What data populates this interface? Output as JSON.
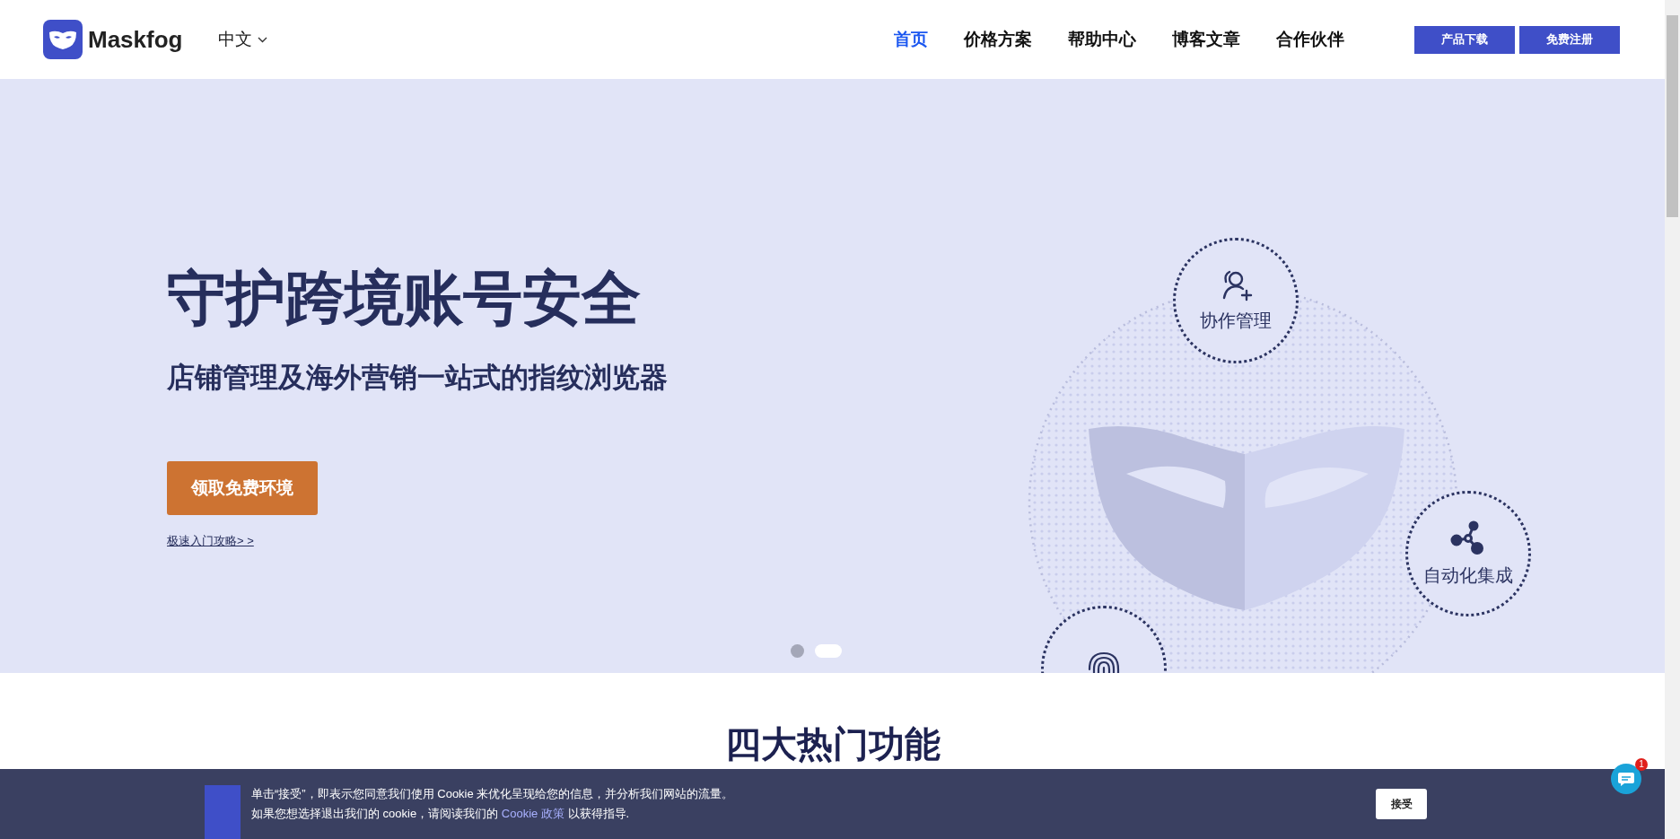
{
  "header": {
    "logo": "Maskfog",
    "language": "中文",
    "nav": [
      {
        "label": "首页",
        "selected": true
      },
      {
        "label": "价格方案",
        "selected": false
      },
      {
        "label": "帮助中心",
        "selected": false
      },
      {
        "label": "博客文章",
        "selected": false
      },
      {
        "label": "合作伙伴",
        "selected": false
      }
    ],
    "buttons": [
      "产品下载",
      "免费注册"
    ]
  },
  "hero": {
    "title": "守护跨境账号安全",
    "subtitle": "店铺管理及海外营销一站式的指纹浏览器",
    "cta": "领取免费环境",
    "link": "极速入门攻略> >",
    "features": [
      {
        "kind": "collaboration",
        "label": "协作管理"
      },
      {
        "kind": "integration",
        "label": "自动化集成"
      },
      {
        "kind": "fingerprint"
      }
    ],
    "slides": [
      {
        "selected": false
      },
      {
        "selected": true
      }
    ]
  },
  "section": {
    "title": "四大热门功能"
  },
  "cookie_banner": {
    "line_1": "单击“接受”，即表示您同意我们使用 Cookie 来优化呈现给您的信息，并分析我们网站的流量。",
    "line_2_before": "如果您想选择退出我们的 cookie，请阅读我们的",
    "link": "Cookie 政策",
    "line_2_after": "以获得指导.",
    "accept": "接受"
  },
  "chat": {
    "badge": "1"
  }
}
